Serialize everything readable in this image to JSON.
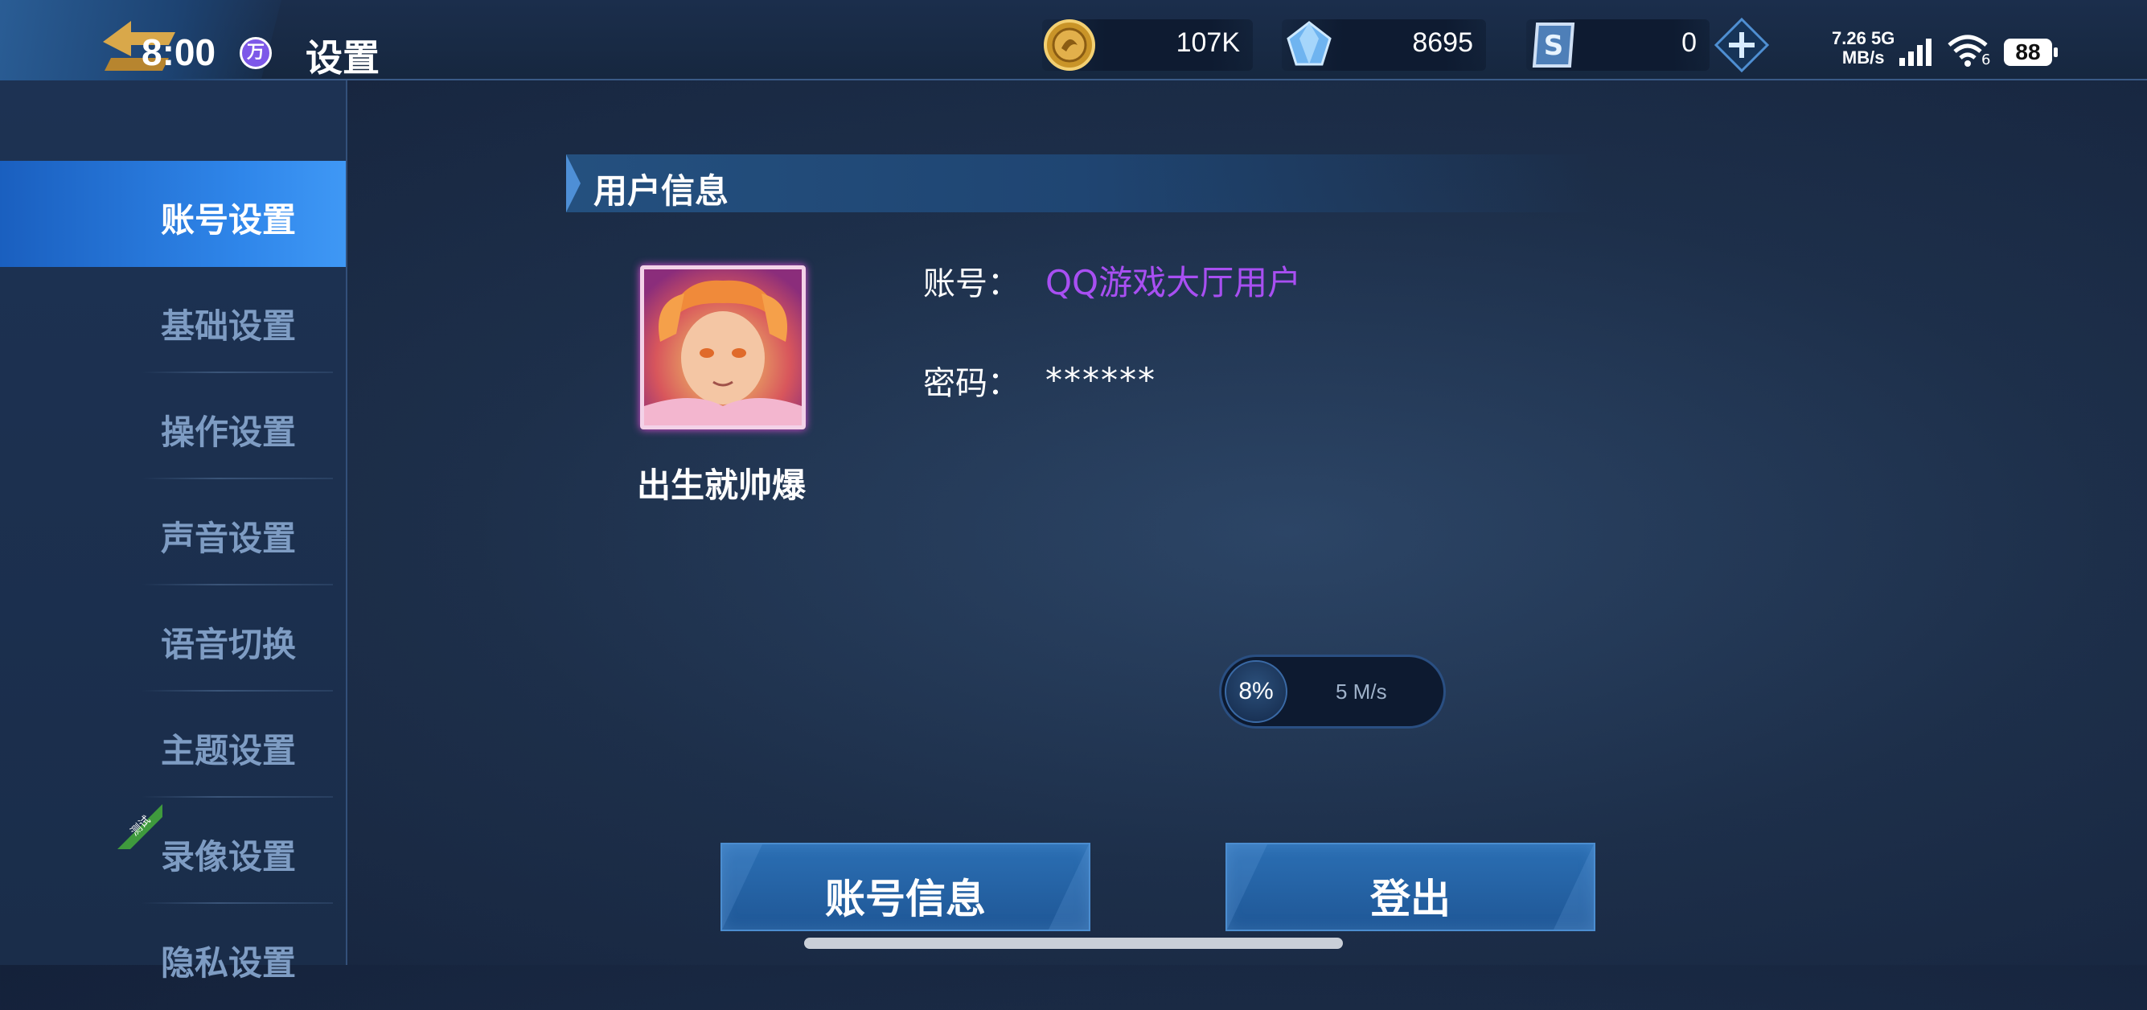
{
  "topbar": {
    "time": "8:00",
    "time_badge": "万",
    "page_title": "设置",
    "resources": [
      {
        "icon": "gold-coin-icon",
        "value": "107K"
      },
      {
        "icon": "diamond-icon",
        "value": "8695"
      },
      {
        "icon": "voucher-icon",
        "value": "0"
      }
    ],
    "add_icon": "plus-icon",
    "status": {
      "speed": "7.26",
      "speed_unit": "MB/s",
      "network": "5G",
      "wifi_label": "6",
      "battery": "88"
    }
  },
  "sidebar": {
    "items": [
      {
        "label": "账号设置",
        "active": true
      },
      {
        "label": "基础设置"
      },
      {
        "label": "操作设置"
      },
      {
        "label": "声音设置"
      },
      {
        "label": "语音切换"
      },
      {
        "label": "主题设置"
      },
      {
        "label": "录像设置",
        "badge": "测试"
      },
      {
        "label": "隐私设置"
      }
    ]
  },
  "user_info": {
    "section_title": "用户信息",
    "nickname": "出生就帅爆",
    "account_label": "账号：",
    "account_value": "QQ游戏大厅用户",
    "password_label": "密码：",
    "password_value": "******"
  },
  "download": {
    "percent": "8%",
    "progress": 0.08,
    "speed": "5 M/s"
  },
  "actions": {
    "account_info": "账号信息",
    "logout": "登出"
  },
  "colors": {
    "accent": "#2f86ea",
    "account_value": "#a84ff2",
    "background": "#1d2f4a"
  }
}
